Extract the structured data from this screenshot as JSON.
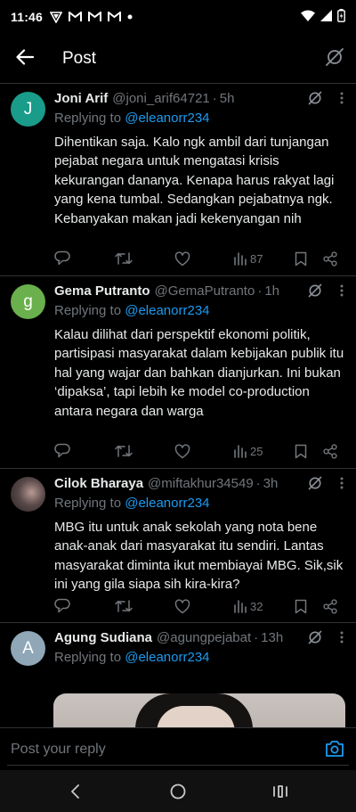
{
  "status_bar": {
    "time": "11:46",
    "notification_icons": [
      "vpn-icon",
      "gmail-icon",
      "gmail-icon",
      "gmail-icon",
      "dot-icon"
    ],
    "system_icons": [
      "wifi-icon",
      "signal-icon",
      "battery-icon"
    ]
  },
  "header": {
    "title": "Post",
    "back_icon": "back-arrow-icon",
    "action_icon": "grok-icon"
  },
  "replying_prefix": "Replying to",
  "replies": [
    {
      "avatar_letter": "J",
      "avatar_color": "#1a9c8a",
      "name": "Joni Arif",
      "handle": "@joni_arif64721",
      "age": "5h",
      "replying_to": "@eleanorr234",
      "text": "Dihentikan saja. Kalo ngk ambil dari tunjangan pejabat negara untuk mengatasi krisis kekurangan dananya. Kenapa harus rakyat lagi yang kena tumbal. Sedangkan pejabatnya ngk. Kebanyakan makan jadi kekenyangan nih",
      "views": "87"
    },
    {
      "avatar_letter": "g",
      "avatar_color": "#6ab04c",
      "name": "Gema Putranto",
      "handle": "@GemaPutranto",
      "age": "1h",
      "replying_to": "@eleanorr234",
      "text": "Kalau dilihat dari perspektif ekonomi politik, partisipasi masyarakat dalam kebijakan publik itu hal yang wajar dan bahkan dianjurkan. Ini bukan ‘dipaksa’, tapi lebih ke model co-production antara negara dan warga",
      "views": "25"
    },
    {
      "avatar_letter": "",
      "avatar_color": "#4a3a3a",
      "name": "Cilok Bharaya",
      "handle": "@miftakhur34549",
      "age": "3h",
      "replying_to": "@eleanorr234",
      "text": "MBG itu untuk anak sekolah yang nota bene anak-anak dari masyarakat itu sendiri. Lantas masyarakat diminta ikut membiayai MBG. Sik,sik ini yang gila siapa sih kira-kira?",
      "views": "32"
    },
    {
      "avatar_letter": "A",
      "avatar_color": "#8fa7b7",
      "name": "Agung Sudiana",
      "handle": "@agungpejabat",
      "age": "13h",
      "replying_to": "@eleanorr234"
    }
  ],
  "composer": {
    "placeholder": "Post your reply",
    "camera_icon": "camera-icon"
  },
  "nav_bar": {
    "icons": [
      "back-nav-icon",
      "home-nav-icon",
      "recents-nav-icon"
    ]
  },
  "colors": {
    "background": "#000000",
    "text": "#e7e9ea",
    "muted": "#71767b",
    "accent": "#1d9bf0",
    "divider": "#2f3336"
  }
}
